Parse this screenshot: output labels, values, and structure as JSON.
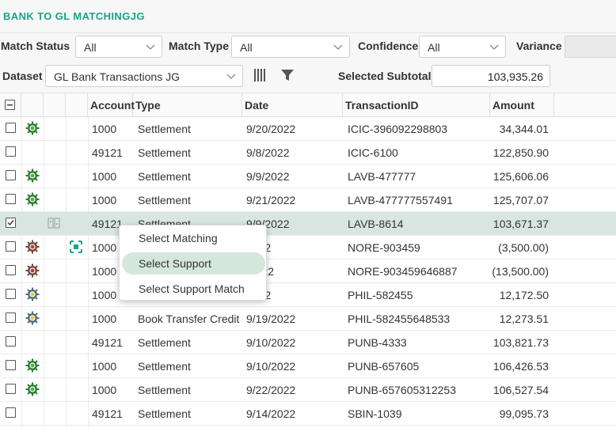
{
  "app": {
    "title": "BANK TO GL MATCHINGJG"
  },
  "filters": {
    "match_status": {
      "label": "Match Status",
      "value": "All"
    },
    "match_type": {
      "label": "Match Type",
      "value": "All"
    },
    "confidence": {
      "label": "Confidence",
      "value": "All"
    },
    "variance": {
      "label": "Variance"
    }
  },
  "dataset": {
    "label": "Dataset",
    "value": "GL Bank Transactions JG"
  },
  "subtotal": {
    "label": "Selected Subtotal",
    "value": "103,935.26"
  },
  "columns": {
    "account": "Account",
    "type": "Type",
    "date": "Date",
    "transaction_id": "TransactionID",
    "amount": "Amount"
  },
  "rows": [
    {
      "checked": false,
      "status_icon": "gear-green",
      "account": "1000",
      "type": "Settlement",
      "date": "9/20/2022",
      "transaction_id": "ICIC-396092298803",
      "amount": "34,344.01"
    },
    {
      "checked": false,
      "status_icon": "",
      "account": "49121",
      "type": "Settlement",
      "date": "9/8/2022",
      "transaction_id": "ICIC-6100",
      "amount": "122,850.90"
    },
    {
      "checked": false,
      "status_icon": "gear-green",
      "account": "1000",
      "type": "Settlement",
      "date": "9/9/2022",
      "transaction_id": "LAVB-477777",
      "amount": "125,606.06"
    },
    {
      "checked": false,
      "status_icon": "gear-green",
      "account": "1000",
      "type": "Settlement",
      "date": "9/21/2022",
      "transaction_id": "LAVB-477777557491",
      "amount": "125,707.07"
    },
    {
      "checked": true,
      "status_icon": "",
      "account": "49121",
      "type": "Settlement",
      "date": "9/9/2022",
      "transaction_id": "LAVB-8614",
      "amount": "103,671.37"
    },
    {
      "checked": false,
      "status_icon": "gear-red",
      "account": "1000",
      "type": "",
      "date": "2022",
      "transaction_id": "NORE-903459",
      "amount": "(3,500.00)"
    },
    {
      "checked": false,
      "status_icon": "gear-red",
      "account": "1000",
      "type": "",
      "date": "/2022",
      "transaction_id": "NORE-903459646887",
      "amount": "(13,500.00)"
    },
    {
      "checked": false,
      "status_icon": "gear-yellow",
      "account": "1000",
      "type": "",
      "date": "2022",
      "transaction_id": "PHIL-582455",
      "amount": "12,172.50"
    },
    {
      "checked": false,
      "status_icon": "gear-yellow",
      "account": "1000",
      "type": "Book Transfer Credit",
      "date": "9/19/2022",
      "transaction_id": "PHIL-582455648533",
      "amount": "12,273.51"
    },
    {
      "checked": false,
      "status_icon": "",
      "account": "49121",
      "type": "Settlement",
      "date": "9/10/2022",
      "transaction_id": "PUNB-4333",
      "amount": "103,821.73"
    },
    {
      "checked": false,
      "status_icon": "gear-green",
      "account": "1000",
      "type": "Settlement",
      "date": "9/10/2022",
      "transaction_id": "PUNB-657605",
      "amount": "106,426.53"
    },
    {
      "checked": false,
      "status_icon": "gear-green",
      "account": "1000",
      "type": "Settlement",
      "date": "9/22/2022",
      "transaction_id": "PUNB-657605312253",
      "amount": "106,527.54"
    },
    {
      "checked": false,
      "status_icon": "",
      "account": "49121",
      "type": "Settlement",
      "date": "9/14/2022",
      "transaction_id": "SBIN-1039",
      "amount": "99,095.73"
    }
  ],
  "context_menu": {
    "items": [
      "Select Matching",
      "Select Support",
      "Select Support Match"
    ],
    "hovered": "Select Support"
  },
  "colors": {
    "accent": "#1aa38a",
    "selected_row": "#d8e6df",
    "menu_hover": "#d5e6dd"
  }
}
